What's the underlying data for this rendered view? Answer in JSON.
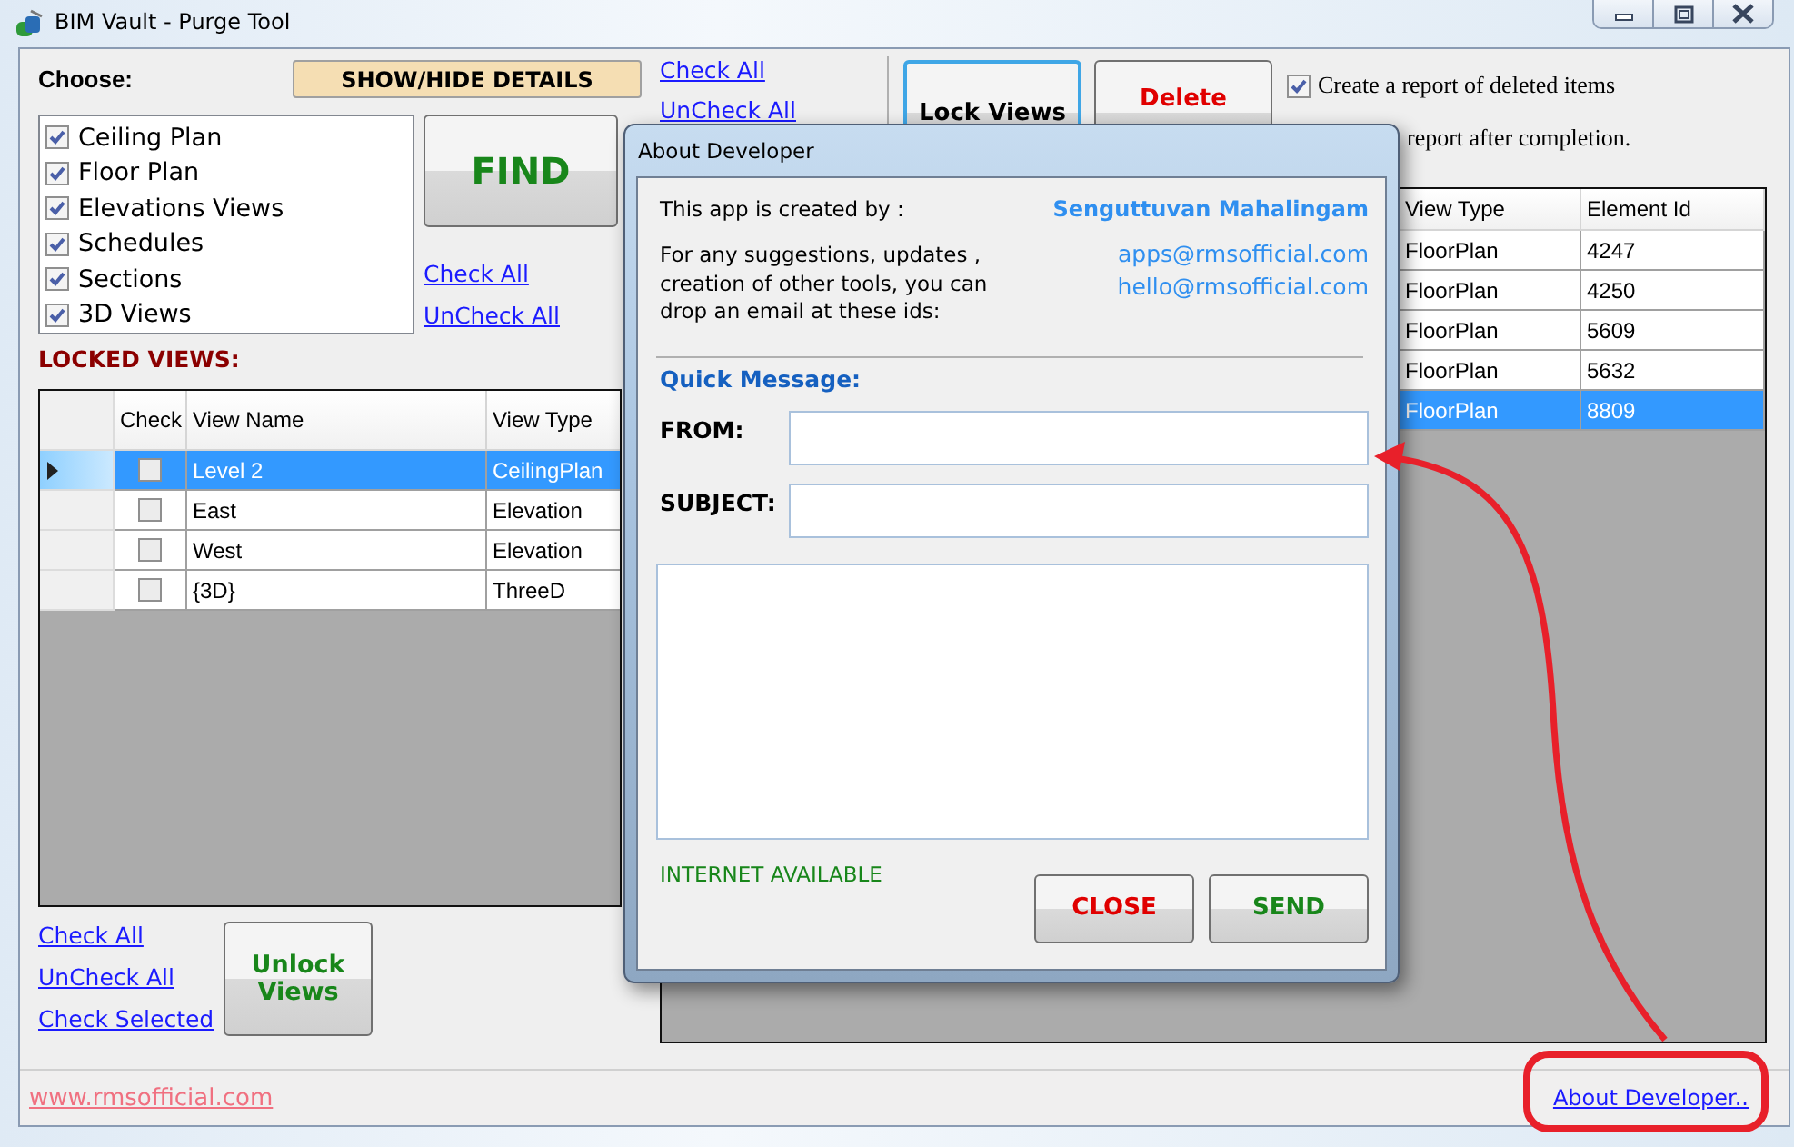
{
  "window": {
    "title": "BIM Vault - Purge Tool"
  },
  "choose": {
    "label": "Choose:",
    "show_hide_button": "SHOW/HIDE DETAILS",
    "find_button": "FIND",
    "categories": [
      {
        "label": "Ceiling Plan",
        "checked": true
      },
      {
        "label": "Floor Plan",
        "checked": true
      },
      {
        "label": "Elevations Views",
        "checked": true
      },
      {
        "label": "Schedules",
        "checked": true
      },
      {
        "label": "Sections",
        "checked": true
      },
      {
        "label": "3D Views",
        "checked": true
      }
    ],
    "links": [
      "Check All",
      "UnCheck All"
    ]
  },
  "locked_views": {
    "label": "LOCKED VIEWS:",
    "columns": [
      "Check",
      "View Name",
      "View Type"
    ],
    "rows": [
      {
        "checked": false,
        "view_name": "Level 2",
        "view_type": "CeilingPlan",
        "selected": true
      },
      {
        "checked": false,
        "view_name": "East",
        "view_type": "Elevation",
        "selected": false
      },
      {
        "checked": false,
        "view_name": "West",
        "view_type": "Elevation",
        "selected": false
      },
      {
        "checked": false,
        "view_name": "{3D}",
        "view_type": "ThreeD",
        "selected": false
      }
    ],
    "links": [
      "Check All",
      "UnCheck All",
      "Check Selected"
    ],
    "unlock_button": "Unlock Views"
  },
  "views": {
    "links": [
      "Check All",
      "UnCheck All"
    ],
    "lock_button": "Lock Views",
    "delete_button": "Delete",
    "options": [
      {
        "label": "Create a report of deleted items",
        "checked": true
      },
      {
        "label": "report after completion."
      }
    ],
    "columns": [
      "View Type",
      "Element Id"
    ],
    "rows": [
      {
        "view_type": "FloorPlan",
        "element_id": "4247",
        "selected": false
      },
      {
        "view_type": "FloorPlan",
        "element_id": "4250",
        "selected": false
      },
      {
        "view_type": "FloorPlan",
        "element_id": "5609",
        "selected": false
      },
      {
        "view_type": "FloorPlan",
        "element_id": "5632",
        "selected": false
      },
      {
        "view_type": "FloorPlan",
        "element_id": "8809",
        "selected": true
      }
    ]
  },
  "status_bar": {
    "website": "www.rmsofficial.com",
    "about_link": "About Developer.."
  },
  "dialog": {
    "title": "About Developer",
    "created_by_label": "This app is created by :",
    "author": "Senguttuvan Mahalingam",
    "contact_text": "For any suggestions, updates ,\ncreation of other tools, you can\ndrop an email at these ids:",
    "emails": [
      "apps@rmsofficial.com",
      "hello@rmsofficial.com"
    ],
    "quick_message": "Quick Message:",
    "fields": [
      {
        "label": "FROM:"
      },
      {
        "label": "SUBJECT:"
      }
    ],
    "status": "INTERNET AVAILABLE",
    "buttons": [
      {
        "label": "CLOSE",
        "kind": "cancel"
      },
      {
        "label": "SEND",
        "kind": "confirm"
      }
    ]
  }
}
